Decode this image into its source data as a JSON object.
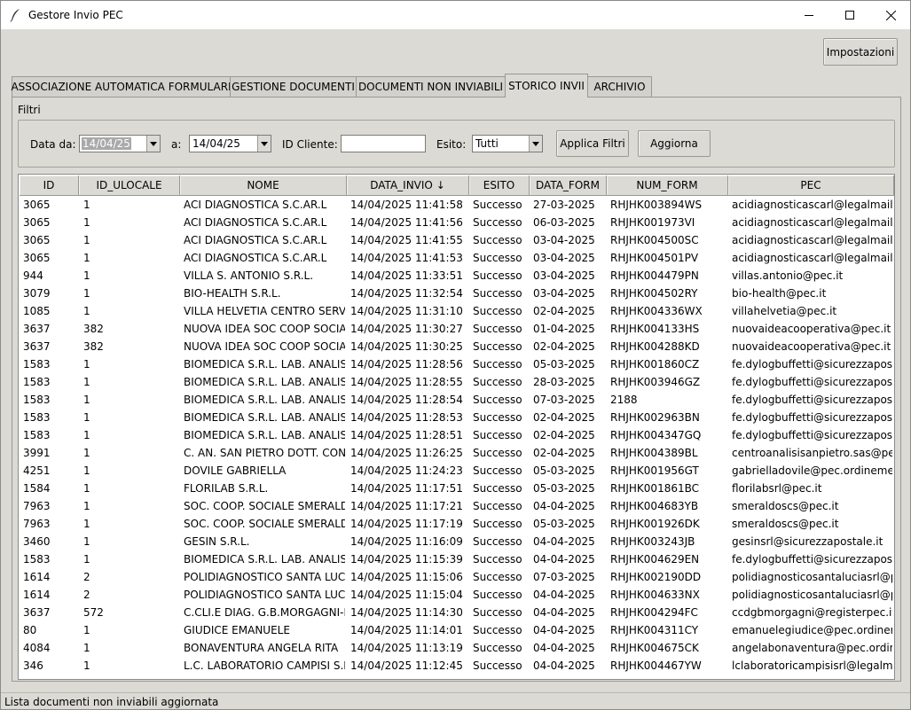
{
  "window": {
    "title": "Gestore Invio PEC"
  },
  "toolbar": {
    "settings_label": "Impostazioni"
  },
  "tabs": [
    {
      "label": "ASSOCIAZIONE AUTOMATICA FORMULARI",
      "active": false
    },
    {
      "label": "GESTIONE DOCUMENTI",
      "active": false
    },
    {
      "label": "DOCUMENTI NON INVIABILI",
      "active": false
    },
    {
      "label": "STORICO INVII",
      "active": true
    },
    {
      "label": "ARCHIVIO",
      "active": false
    }
  ],
  "filters": {
    "section_label": "Filtri",
    "date_from_label": "Data da:",
    "date_from_value": "14/04/25",
    "date_to_label": "a:",
    "date_to_value": "14/04/25",
    "client_id_label": "ID Cliente:",
    "client_id_value": "",
    "outcome_label": "Esito:",
    "outcome_value": "Tutti",
    "apply_label": "Applica Filtri",
    "refresh_label": "Aggiorna"
  },
  "table": {
    "columns": [
      "ID",
      "ID_ULOCALE",
      "NOME",
      "DATA_INVIO ↓",
      "ESITO",
      "DATA_FORM",
      "NUM_FORM",
      "PEC"
    ],
    "rows": [
      [
        "3065",
        "1",
        "ACI DIAGNOSTICA S.C.AR.L",
        "14/04/2025 11:41:58",
        "Successo",
        "27-03-2025",
        "RHJHK003894WS",
        "acidiagnosticascarl@legalmail.it"
      ],
      [
        "3065",
        "1",
        "ACI DIAGNOSTICA S.C.AR.L",
        "14/04/2025 11:41:56",
        "Successo",
        "06-03-2025",
        "RHJHK001973VI",
        "acidiagnosticascarl@legalmail.it"
      ],
      [
        "3065",
        "1",
        "ACI DIAGNOSTICA S.C.AR.L",
        "14/04/2025 11:41:55",
        "Successo",
        "03-04-2025",
        "RHJHK004500SC",
        "acidiagnosticascarl@legalmail.it"
      ],
      [
        "3065",
        "1",
        "ACI DIAGNOSTICA S.C.AR.L",
        "14/04/2025 11:41:53",
        "Successo",
        "03-04-2025",
        "RHJHK004501PV",
        "acidiagnosticascarl@legalmail.it"
      ],
      [
        "944",
        "1",
        "VILLA S. ANTONIO S.R.L.",
        "14/04/2025 11:33:51",
        "Successo",
        "03-04-2025",
        "RHJHK004479PN",
        "villas.antonio@pec.it"
      ],
      [
        "3079",
        "1",
        "BIO-HEALTH S.R.L.",
        "14/04/2025 11:32:54",
        "Successo",
        "03-04-2025",
        "RHJHK004502RY",
        "bio-health@pec.it"
      ],
      [
        "1085",
        "1",
        "VILLA HELVETIA CENTRO SERVIZI S",
        "14/04/2025 11:31:10",
        "Successo",
        "02-04-2025",
        "RHJHK004336WX",
        "villahelvetia@pec.it"
      ],
      [
        "3637",
        "382",
        "NUOVA IDEA SOC COOP SOCIALE",
        "14/04/2025 11:30:27",
        "Successo",
        "01-04-2025",
        "RHJHK004133HS",
        "nuovaideacooperativa@pec.it"
      ],
      [
        "3637",
        "382",
        "NUOVA IDEA SOC COOP SOCIALE",
        "14/04/2025 11:30:25",
        "Successo",
        "02-04-2025",
        "RHJHK004288KD",
        "nuovaideacooperativa@pec.it"
      ],
      [
        "1583",
        "1",
        "BIOMEDICA S.R.L. LAB. ANALISI",
        "14/04/2025 11:28:56",
        "Successo",
        "05-03-2025",
        "RHJHK001860CZ",
        "fe.dylogbuffetti@sicurezzapostale"
      ],
      [
        "1583",
        "1",
        "BIOMEDICA S.R.L. LAB. ANALISI",
        "14/04/2025 11:28:55",
        "Successo",
        "28-03-2025",
        "RHJHK003946GZ",
        "fe.dylogbuffetti@sicurezzapostale"
      ],
      [
        "1583",
        "1",
        "BIOMEDICA S.R.L. LAB. ANALISI",
        "14/04/2025 11:28:54",
        "Successo",
        "07-03-2025",
        "2188",
        "fe.dylogbuffetti@sicurezzapostale"
      ],
      [
        "1583",
        "1",
        "BIOMEDICA S.R.L. LAB. ANALISI",
        "14/04/2025 11:28:53",
        "Successo",
        "02-04-2025",
        "RHJHK002963BN",
        "fe.dylogbuffetti@sicurezzapostale"
      ],
      [
        "1583",
        "1",
        "BIOMEDICA S.R.L. LAB. ANALISI",
        "14/04/2025 11:28:51",
        "Successo",
        "02-04-2025",
        "RHJHK004347GQ",
        "fe.dylogbuffetti@sicurezzapostale"
      ],
      [
        "3991",
        "1",
        "C. AN. SAN PIETRO DOTT. CONSO",
        "14/04/2025 11:26:25",
        "Successo",
        "02-04-2025",
        "RHJHK004389BL",
        "centroanalisisanpietro.sas@pec.it"
      ],
      [
        "4251",
        "1",
        "DOVILE GABRIELLA",
        "14/04/2025 11:24:23",
        "Successo",
        "05-03-2025",
        "RHJHK001956GT",
        "gabrielladovile@pec.ordinemedct"
      ],
      [
        "1584",
        "1",
        "FLORILAB S.R.L.",
        "14/04/2025 11:17:51",
        "Successo",
        "05-03-2025",
        "RHJHK001861BC",
        "florilabsrl@pec.it"
      ],
      [
        "7963",
        "1",
        "SOC. COOP. SOCIALE SMERALDO",
        "14/04/2025 11:17:21",
        "Successo",
        "04-04-2025",
        "RHJHK004683YB",
        "smeraldoscs@pec.it"
      ],
      [
        "7963",
        "1",
        "SOC. COOP. SOCIALE SMERALDO",
        "14/04/2025 11:17:19",
        "Successo",
        "05-03-2025",
        "RHJHK001926DK",
        "smeraldoscs@pec.it"
      ],
      [
        "3460",
        "1",
        "GESIN S.R.L.",
        "14/04/2025 11:16:09",
        "Successo",
        "04-04-2025",
        "RHJHK003243JB",
        "gesinsrl@sicurezzapostale.it"
      ],
      [
        "1583",
        "1",
        "BIOMEDICA S.R.L. LAB. ANALISI",
        "14/04/2025 11:15:39",
        "Successo",
        "04-04-2025",
        "RHJHK004629EN",
        "fe.dylogbuffetti@sicurezzapostale"
      ],
      [
        "1614",
        "2",
        "POLIDIAGNOSTICO SANTA LUCIA",
        "14/04/2025 11:15:06",
        "Successo",
        "07-03-2025",
        "RHJHK002190DD",
        "polidiagnosticosantaluciasrl@pec."
      ],
      [
        "1614",
        "2",
        "POLIDIAGNOSTICO SANTA LUCIA",
        "14/04/2025 11:15:04",
        "Successo",
        "04-04-2025",
        "RHJHK004633NX",
        "polidiagnosticosantaluciasrl@pec."
      ],
      [
        "3637",
        "572",
        "C.CLI.E DIAG. G.B.MORGAGNI-MC",
        "14/04/2025 11:14:30",
        "Successo",
        "04-04-2025",
        "RHJHK004294FC",
        "ccdgbmorgagni@registerpec.it"
      ],
      [
        "80",
        "1",
        "GIUDICE  EMANUELE",
        "14/04/2025 11:14:01",
        "Successo",
        "04-04-2025",
        "RHJHK004311CY",
        "emanuelegiudice@pec.ordinemed"
      ],
      [
        "4084",
        "1",
        "BONAVENTURA ANGELA RITA",
        "14/04/2025 11:13:19",
        "Successo",
        "04-04-2025",
        "RHJHK004675CK",
        "angelabonaventura@pec.ordinem"
      ],
      [
        "346",
        "1",
        "L.C. LABORATORIO CAMPISI S.R.L",
        "14/04/2025 11:12:45",
        "Successo",
        "04-04-2025",
        "RHJHK004467YW",
        "lclaboratoricampisisrl@legalmail.i"
      ]
    ]
  },
  "statusbar": {
    "text": "Lista documenti non inviabili aggiornata"
  }
}
